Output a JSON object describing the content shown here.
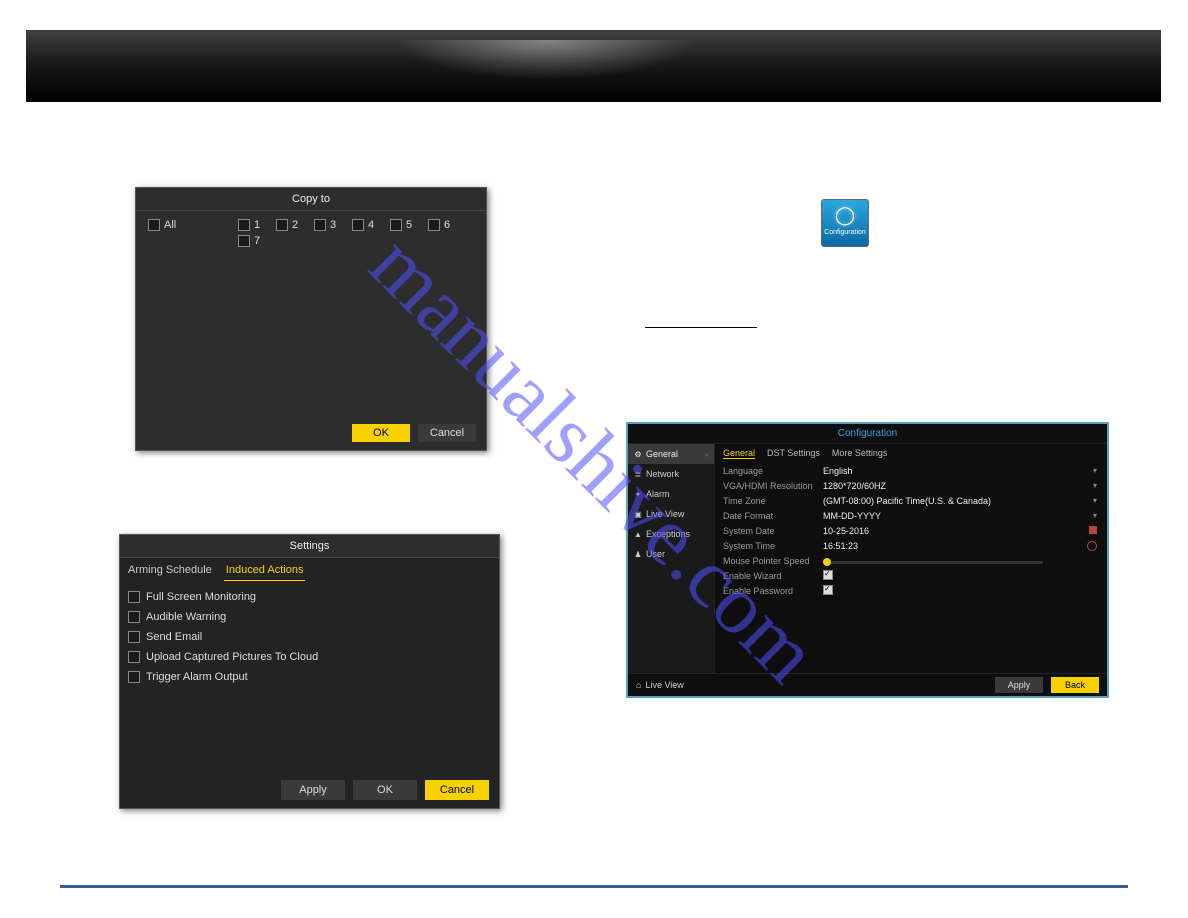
{
  "watermark": "manualshive.com",
  "copy_dialog": {
    "title": "Copy to",
    "items": [
      "All",
      "1",
      "2",
      "3",
      "4",
      "5",
      "6",
      "7"
    ],
    "ok": "OK",
    "cancel": "Cancel"
  },
  "settings_dialog": {
    "title": "Settings",
    "tabs": [
      "Arming Schedule",
      "Induced Actions"
    ],
    "active_tab": 1,
    "options": [
      "Full Screen Monitoring",
      "Audible Warning",
      "Send Email",
      "Upload Captured Pictures To Cloud",
      "Trigger Alarm Output"
    ],
    "apply": "Apply",
    "ok": "OK",
    "cancel": "Cancel"
  },
  "config_icon": {
    "label": "Configuration"
  },
  "config_win": {
    "title": "Configuration",
    "sidebar": [
      {
        "icon": "⚙",
        "label": "General",
        "active": true
      },
      {
        "icon": "≣",
        "label": "Network"
      },
      {
        "icon": "✦",
        "label": "Alarm"
      },
      {
        "icon": "▣",
        "label": "Live View"
      },
      {
        "icon": "▲",
        "label": "Exceptions"
      },
      {
        "icon": "♟",
        "label": "User"
      }
    ],
    "tabs": [
      "General",
      "DST Settings",
      "More Settings"
    ],
    "rows": {
      "language_label": "Language",
      "language_value": "English",
      "res_label": "VGA/HDMI Resolution",
      "res_value": "1280*720/60HZ",
      "tz_label": "Time Zone",
      "tz_value": "(GMT-08:00) Pacific Time(U.S. & Canada)",
      "df_label": "Date Format",
      "df_value": "MM-DD-YYYY",
      "sd_label": "System Date",
      "sd_value": "10-25-2016",
      "st_label": "System Time",
      "st_value": "16:51:23",
      "mps_label": "Mouse Pointer Speed",
      "ew_label": "Enable Wizard",
      "ep_label": "Enable Password"
    },
    "footer": {
      "live_view": "Live View",
      "apply": "Apply",
      "back": "Back"
    }
  }
}
